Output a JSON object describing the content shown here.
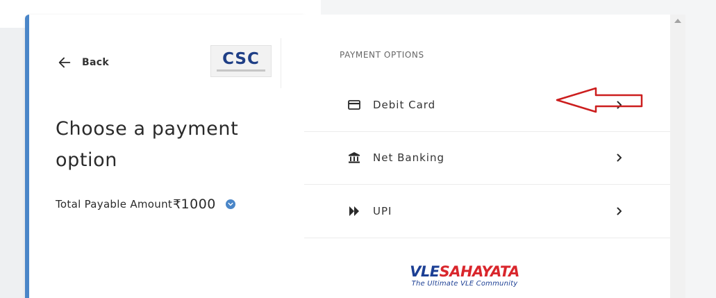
{
  "header": {
    "back_label": "Back",
    "logo_text": "CSC"
  },
  "left": {
    "title": "Choose a payment option",
    "amount_label": "Total Payable Amount",
    "currency_symbol": "₹",
    "amount_value": "1000"
  },
  "payment": {
    "heading": "PAYMENT OPTIONS",
    "options": [
      {
        "label": "Debit Card",
        "icon": "credit-card-icon"
      },
      {
        "label": "Net Banking",
        "icon": "bank-icon"
      },
      {
        "label": "UPI",
        "icon": "upi-icon"
      }
    ]
  },
  "footer_logo": {
    "part1": "VLE",
    "part2": "SAHAYATA",
    "tagline": "The Ultimate VLE Community"
  },
  "colors": {
    "accent": "#4a86c8",
    "annotation_arrow": "#cc1e1e",
    "vle_blue": "#1c3f94",
    "vle_red": "#d9262c"
  }
}
